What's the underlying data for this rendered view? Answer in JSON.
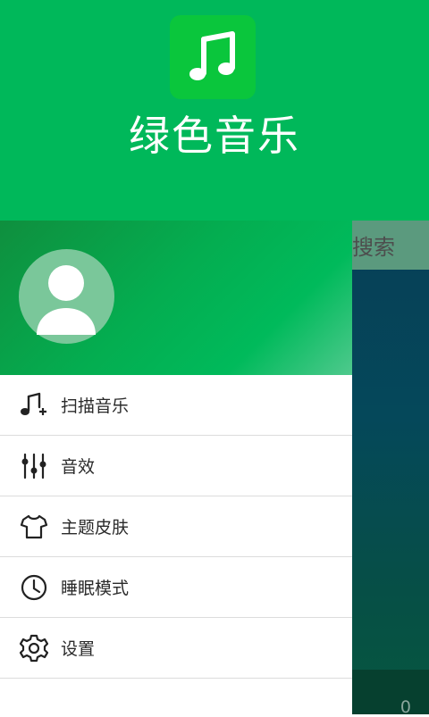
{
  "app": {
    "title": "绿色音乐",
    "logo_icon": "music-note-icon",
    "brand_color": "#00b85a"
  },
  "background_screen": {
    "search_label": "搜索",
    "count": "0"
  },
  "drawer": {
    "avatar_icon": "user-avatar-icon",
    "items": [
      {
        "label": "扫描音乐",
        "icon": "music-scan-icon"
      },
      {
        "label": "音效",
        "icon": "equalizer-icon"
      },
      {
        "label": "主题皮肤",
        "icon": "t-shirt-icon"
      },
      {
        "label": "睡眠模式",
        "icon": "clock-icon"
      },
      {
        "label": "设置",
        "icon": "gear-icon"
      }
    ]
  }
}
